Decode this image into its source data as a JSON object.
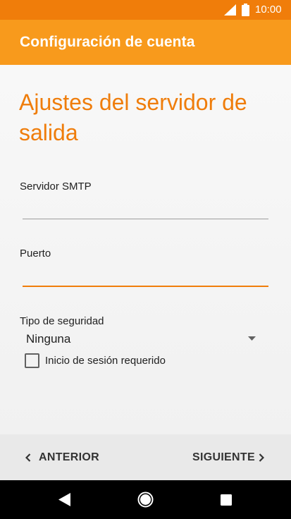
{
  "status_bar": {
    "time": "10:00",
    "icons": [
      "signal-icon",
      "battery-icon"
    ]
  },
  "app_bar": {
    "title": "Configuración de cuenta"
  },
  "main": {
    "heading": "Ajustes del servidor de salida",
    "fields": [
      {
        "label": "Servidor SMTP",
        "value": ""
      },
      {
        "label": "Puerto",
        "value": ""
      }
    ],
    "security": {
      "label": "Tipo de seguridad",
      "selected": "Ninguna"
    },
    "login_checkbox": {
      "label": "Inicio de sesión requerido",
      "checked": false
    }
  },
  "bottom_bar": {
    "prev_label": "ANTERIOR",
    "next_label": "SIGUIENTE"
  },
  "system_nav": {
    "icons": [
      "back-icon",
      "home-icon",
      "recent-apps-icon"
    ]
  },
  "colors": {
    "status_bar": "#f07d0a",
    "app_bar": "#f89a1c",
    "accent": "#ef7d0b"
  }
}
